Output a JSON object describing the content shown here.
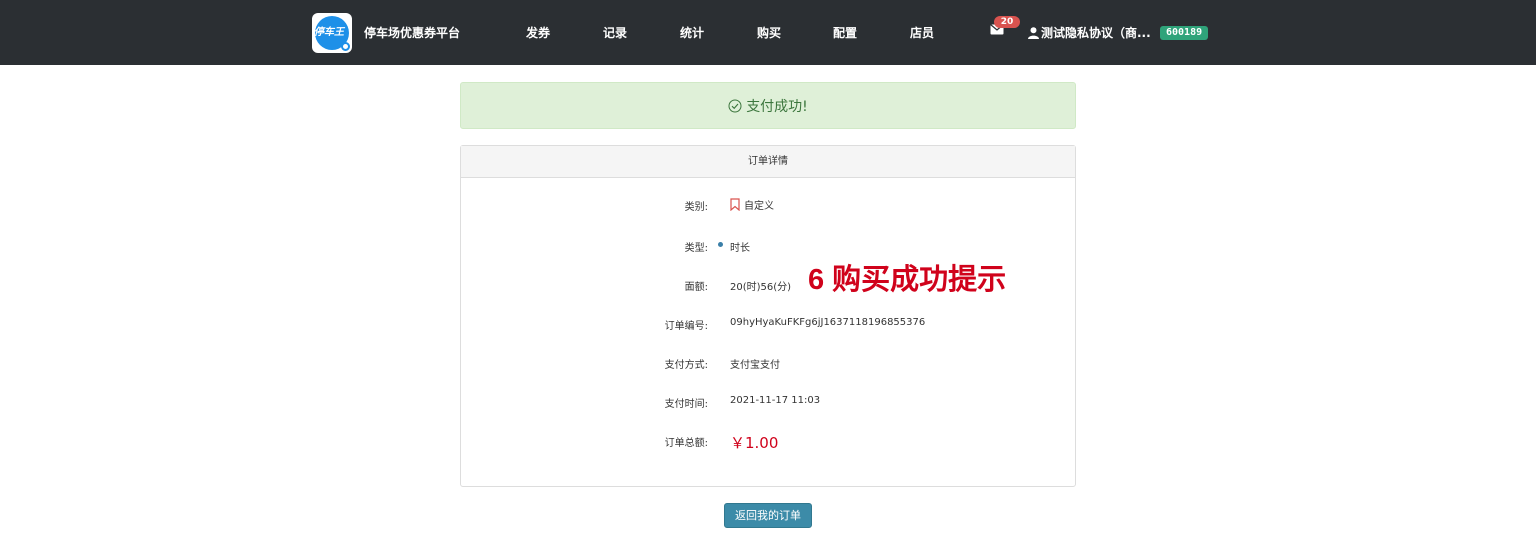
{
  "header": {
    "logo_text": "停车王",
    "brand": "停车场优惠券平台",
    "nav": [
      "发券",
      "记录",
      "统计",
      "购买",
      "配置",
      "店员"
    ],
    "mail_count": "20",
    "user_name": "测试隐私协议（商...",
    "balance": "600189",
    "colors": {
      "bar": "#2b2f33",
      "badge_red": "#d9534f",
      "badge_green": "#2fa37a"
    }
  },
  "alert": {
    "icon": "check-circle-icon",
    "text": "支付成功!"
  },
  "order": {
    "title": "订单详情",
    "rows": [
      {
        "label": "类别:",
        "value": "自定义",
        "icon": "bookmark-icon"
      },
      {
        "label": "类型:",
        "value": "时长",
        "icon": "bullet-icon"
      },
      {
        "label": "面额:",
        "value": "20(时)56(分)"
      },
      {
        "label": "订单编号:",
        "value": "09hyHyaKuFKFg6jJ1637118196855376"
      },
      {
        "label": "支付方式:",
        "value": "支付宝支付"
      },
      {
        "label": "支付时间:",
        "value": "2021-11-17 11:03"
      },
      {
        "label": "订单总额:",
        "value": "￥1.00"
      }
    ]
  },
  "annotation": "6 购买成功提示",
  "back_button": "返回我的订单"
}
